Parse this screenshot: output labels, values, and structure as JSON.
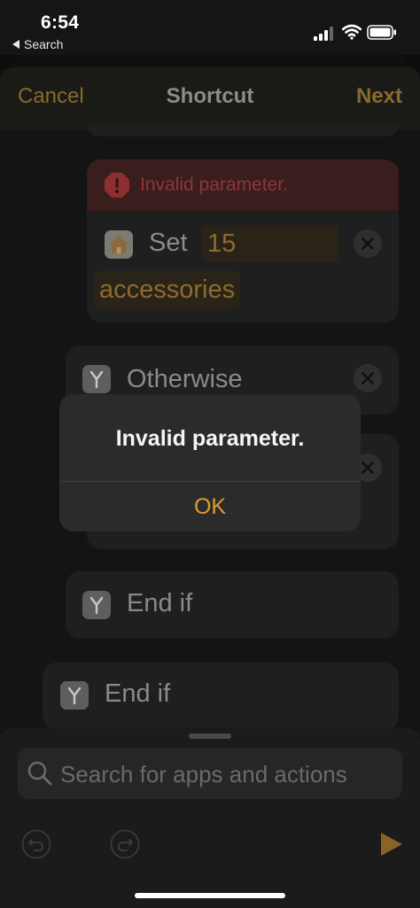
{
  "status_bar": {
    "time": "6:54",
    "back_label": "Search"
  },
  "nav": {
    "cancel": "Cancel",
    "title": "Shortcut",
    "next": "Next"
  },
  "error_action": {
    "error_message": "Invalid parameter.",
    "verb": "Set",
    "value_token": "15",
    "object_token": "accessories"
  },
  "otherwise_action": {
    "label": "Otherwise"
  },
  "end_if_inner": {
    "label": "End if"
  },
  "end_if_outer": {
    "label": "End if"
  },
  "alert": {
    "title": "Invalid parameter.",
    "ok_label": "OK"
  },
  "search": {
    "placeholder": "Search for apps and actions"
  },
  "colors": {
    "accent": "#e09a2c",
    "error": "#c0392b",
    "background": "#141414"
  }
}
